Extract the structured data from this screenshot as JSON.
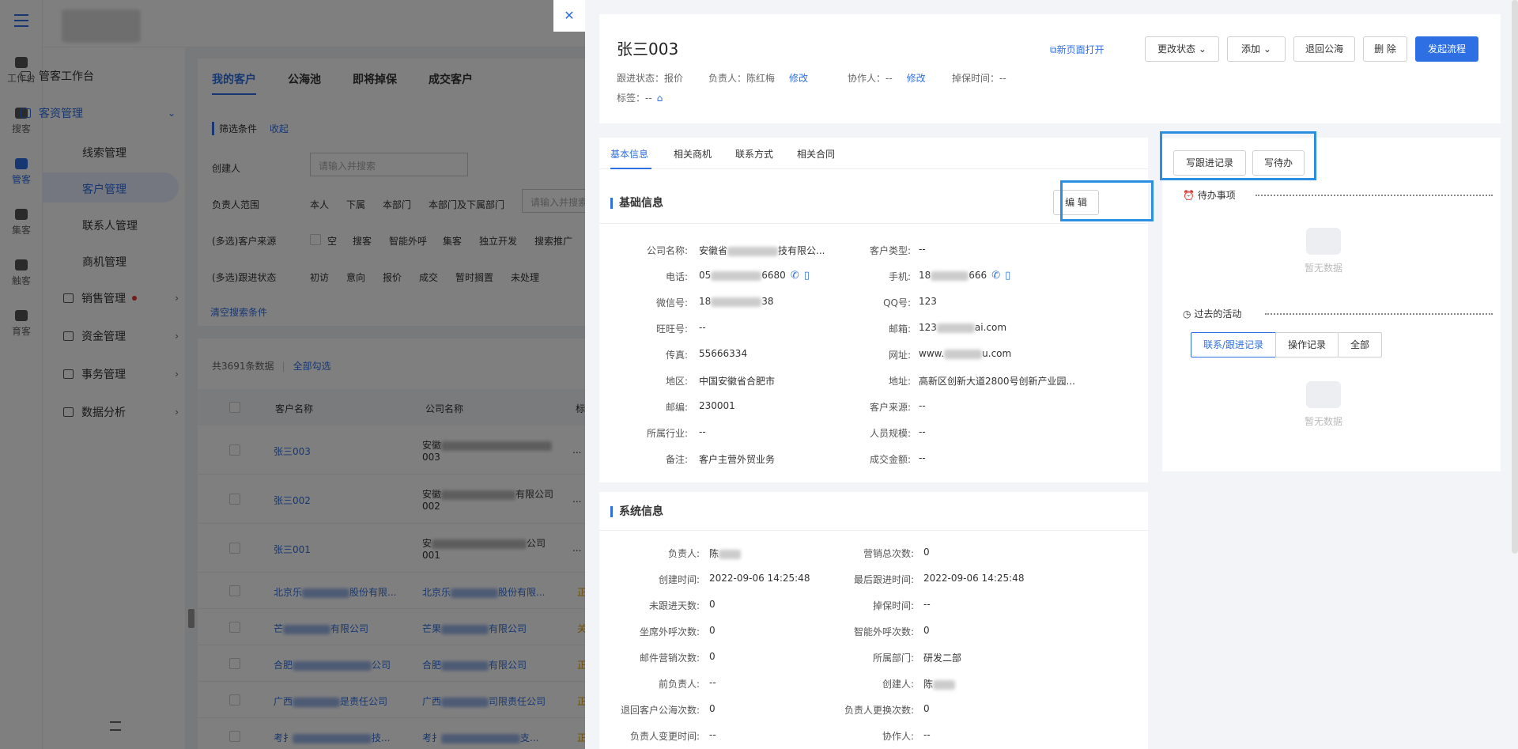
{
  "rail": [
    {
      "label": "工作台",
      "icon": "workbench-icon"
    },
    {
      "label": "搜客",
      "icon": "search-customer-icon"
    },
    {
      "label": "管客",
      "icon": "cloud-icon",
      "active": true
    },
    {
      "label": "集客",
      "icon": "group-icon"
    },
    {
      "label": "触客",
      "icon": "user-icon"
    },
    {
      "label": "育客",
      "icon": "people-icon"
    }
  ],
  "menu": {
    "items": [
      {
        "label": "管客工作台",
        "icon": "home-icon"
      },
      {
        "label": "客资管理",
        "icon": "customer-icon",
        "expanded": true
      },
      {
        "label": "线索管理"
      },
      {
        "label": "客户管理",
        "active": true
      },
      {
        "label": "联系人管理"
      },
      {
        "label": "商机管理"
      },
      {
        "label": "销售管理",
        "icon": "sales-icon"
      },
      {
        "label": "资金管理",
        "icon": "fund-icon"
      },
      {
        "label": "事务管理",
        "icon": "affair-icon"
      },
      {
        "label": "数据分析",
        "icon": "chart-icon"
      }
    ]
  },
  "list_tabs": [
    "我的客户",
    "公海池",
    "即将掉保",
    "成交客户"
  ],
  "filter": {
    "title": "筛选条件",
    "collapse": "收起",
    "creator_label": "创建人",
    "creator_placeholder": "请输入并搜索",
    "owner_label": "负责人范围",
    "owner_opts": [
      "本人",
      "下属",
      "本部门",
      "本部门及下属部门"
    ],
    "owner_placeholder": "请输入并搜索",
    "source_label": "(多选)客户来源",
    "source_opts": [
      "空",
      "搜客",
      "智能外呼",
      "集客",
      "独立开发",
      "搜索推广"
    ],
    "status_label": "(多选)跟进状态",
    "status_opts": [
      "初访",
      "意向",
      "报价",
      "成交",
      "暂时搁置",
      "未处理"
    ],
    "clear": "清空搜索条件"
  },
  "list": {
    "count": "共3691条数据",
    "select_all": "全部勾选",
    "col_customer": "客户名称",
    "col_company": "公司名称",
    "col_tag": "标",
    "rows": [
      {
        "name": "张三003",
        "company": "安徽",
        "company2": "003",
        "tag": "..."
      },
      {
        "name": "张三002",
        "company": "安徽",
        "company_tail": "有限公司",
        "company2": "002",
        "tag": "..."
      },
      {
        "name": "张三001",
        "company": "安",
        "company_tail": "公司",
        "company2": "001",
        "tag": "..."
      },
      {
        "name": "北京乐",
        "name_tail": "股份有限...",
        "company": "北京乐",
        "company_tail": "股份有限...",
        "tag": "正"
      },
      {
        "name": "芒",
        "name_tail": "有限公司",
        "company": "芒果",
        "company_tail": "有限公司",
        "tag": "关"
      },
      {
        "name": "合肥",
        "name_tail": "公司",
        "company": "合肥",
        "company_tail": "有限公司",
        "tag": "正"
      },
      {
        "name": "广西",
        "name_tail": "是责任公司",
        "company": "广西",
        "company_tail": "司限责任公司",
        "tag": "正"
      },
      {
        "name": "考扌",
        "name_tail": "技...",
        "company": "考扌",
        "company_tail": "支...",
        "tag": "正"
      }
    ]
  },
  "detail": {
    "name": "张三003",
    "follow_status": "跟进状态：报价",
    "owner": "负责人：陈红梅",
    "modify": "修改",
    "collaborator": "协作人：--",
    "modify2": "修改",
    "drop_time": "掉保时间：--",
    "tags": "标签：--",
    "open_new": "新页面打开",
    "change_status": "更改状态",
    "add": "添加",
    "return_pool": "退回公海",
    "delete": "删 除",
    "start_flow": "发起流程",
    "tabs": [
      "基本信息",
      "相关商机",
      "联系方式",
      "相关合同"
    ],
    "basic_title": "基础信息",
    "edit": "编 辑",
    "basic_left": [
      {
        "k": "公司名称:",
        "v": "安徽省",
        "v2": "技有限公..."
      },
      {
        "k": "电话:",
        "v": "05",
        "v2": "6680",
        "phone": true
      },
      {
        "k": "微信号:",
        "v": "18",
        "v2": "38"
      },
      {
        "k": "旺旺号:",
        "v": "--"
      },
      {
        "k": "传真:",
        "v": "55666334"
      },
      {
        "k": "地区:",
        "v": "中国安徽省合肥市"
      },
      {
        "k": "邮编:",
        "v": "230001"
      },
      {
        "k": "所属行业:",
        "v": "--"
      },
      {
        "k": "备注:",
        "v": "客户主营外贸业务"
      }
    ],
    "basic_right": [
      {
        "k": "客户类型:",
        "v": "--"
      },
      {
        "k": "手机:",
        "v": "18",
        "v2": "666",
        "phone": true
      },
      {
        "k": "QQ号:",
        "v": "123"
      },
      {
        "k": "邮箱:",
        "v": "123",
        "v2": "ai.com"
      },
      {
        "k": "网址:",
        "v": "www.",
        "v2": "u.com"
      },
      {
        "k": "地址:",
        "v": "高新区创新大道2800号创新产业园..."
      },
      {
        "k": "客户来源:",
        "v": "--"
      },
      {
        "k": "人员规模:",
        "v": "--"
      },
      {
        "k": "成交金额:",
        "v": "--"
      }
    ],
    "system_title": "系统信息",
    "sys_left": [
      {
        "k": "负责人:",
        "v": "陈"
      },
      {
        "k": "创建时间:",
        "v": "2022-09-06 14:25:48"
      },
      {
        "k": "未跟进天数:",
        "v": "0"
      },
      {
        "k": "坐席外呼次数:",
        "v": "0"
      },
      {
        "k": "邮件营销次数:",
        "v": "0"
      },
      {
        "k": "前负责人:",
        "v": "--"
      },
      {
        "k": "退回客户公海次数:",
        "v": "0"
      },
      {
        "k": "负责人变更时间:",
        "v": "--"
      }
    ],
    "sys_right": [
      {
        "k": "营销总次数:",
        "v": "0"
      },
      {
        "k": "最后跟进时间:",
        "v": "2022-09-06 14:25:48"
      },
      {
        "k": "掉保时间:",
        "v": "--"
      },
      {
        "k": "智能外呼次数:",
        "v": "0"
      },
      {
        "k": "所属部门:",
        "v": "研发二部"
      },
      {
        "k": "创建人:",
        "v": "陈"
      },
      {
        "k": "负责人更换次数:",
        "v": "0"
      },
      {
        "k": "协作人:",
        "v": "--"
      }
    ],
    "write_follow": "写跟进记录",
    "write_todo": "写待办",
    "todo_title": "待办事项",
    "past_title": "过去的活动",
    "no_data": "暂无数据",
    "activity_tabs": [
      "联系/跟进记录",
      "操作记录",
      "全部"
    ]
  }
}
